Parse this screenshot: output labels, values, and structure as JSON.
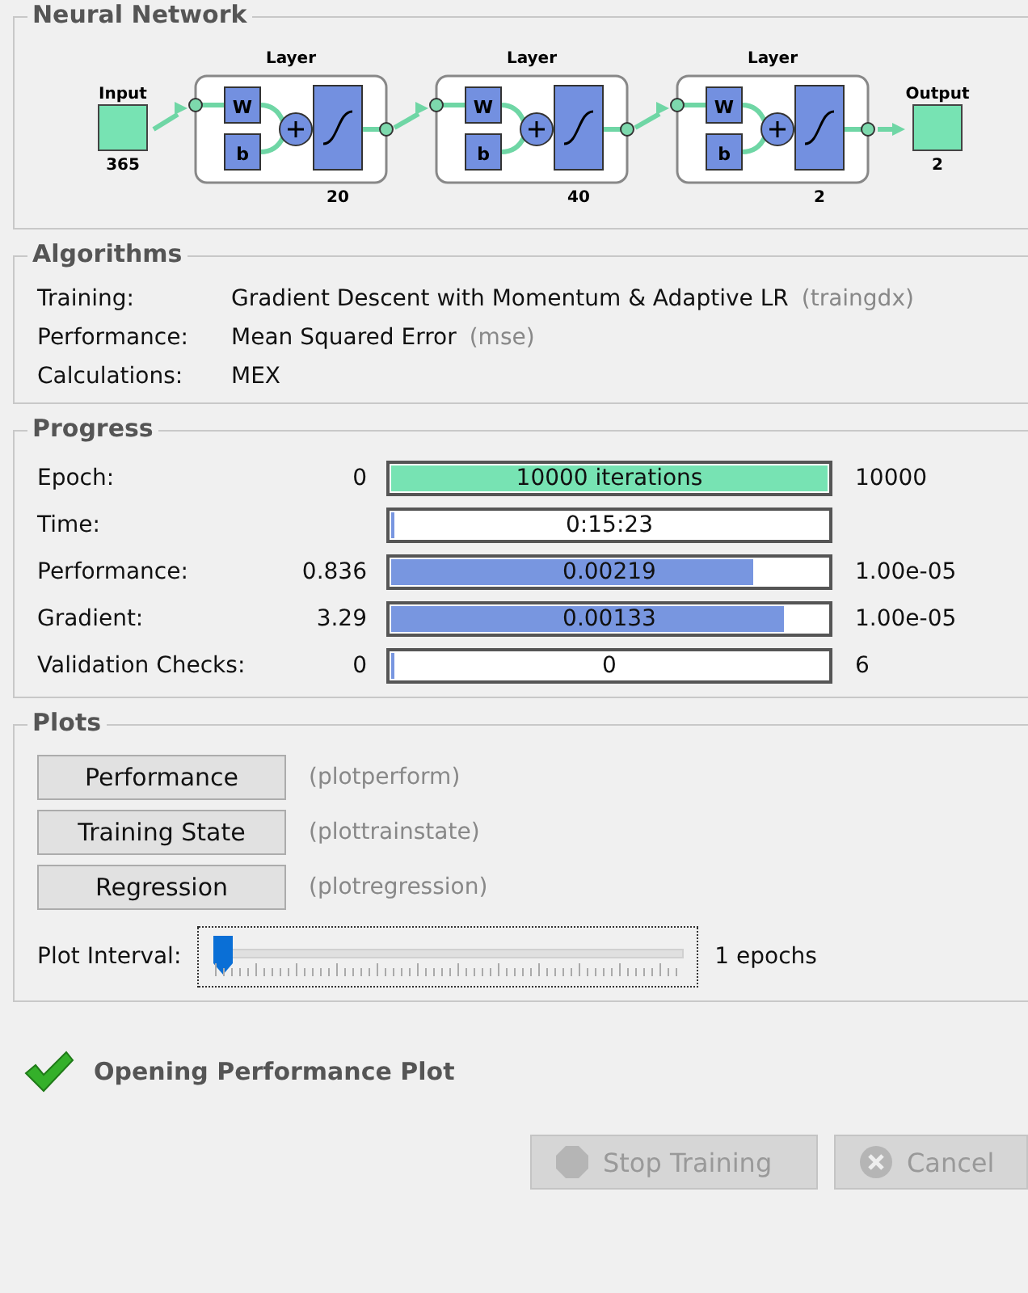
{
  "neural_network": {
    "title": "Neural Network",
    "input": {
      "label": "Input",
      "size": "365"
    },
    "layers": [
      {
        "label": "Layer",
        "size": "20",
        "weight_label": "W",
        "bias_label": "b"
      },
      {
        "label": "Layer",
        "size": "40",
        "weight_label": "W",
        "bias_label": "b"
      },
      {
        "label": "Layer",
        "size": "2",
        "weight_label": "W",
        "bias_label": "b"
      }
    ],
    "output": {
      "label": "Output",
      "size": "2"
    }
  },
  "algorithms": {
    "title": "Algorithms",
    "rows": [
      {
        "label": "Training:",
        "value": "Gradient Descent with Momentum & Adaptive LR",
        "code": "(traingdx)"
      },
      {
        "label": "Performance:",
        "value": "Mean Squared Error",
        "code": "(mse)"
      },
      {
        "label": "Calculations:",
        "value": "MEX"
      }
    ]
  },
  "progress": {
    "title": "Progress",
    "rows": [
      {
        "label": "Epoch:",
        "start": "0",
        "bar_text": "10000 iterations",
        "level": 1,
        "color": "#77e3b3",
        "end": "10000"
      },
      {
        "label": "Time:",
        "bar_text": "0:15:23",
        "level": 0,
        "color": "#7896e0"
      },
      {
        "label": "Performance:",
        "start": "0.836",
        "bar_text": "0.00219",
        "level": 0.83,
        "color": "#7896e0",
        "end": "1.00e-05"
      },
      {
        "label": "Gradient:",
        "start": "3.29",
        "bar_text": "0.00133",
        "level": 0.9,
        "color": "#7896e0",
        "end": "1.00e-05"
      },
      {
        "label": "Validation Checks:",
        "start": "0",
        "bar_text": "0",
        "level": 0,
        "color": "#7896e0",
        "end": "6"
      }
    ]
  },
  "plots": {
    "title": "Plots",
    "buttons": [
      {
        "label": "Performance",
        "function": "(plotperform)"
      },
      {
        "label": "Training State",
        "function": "(plottrainstate)"
      },
      {
        "label": "Regression",
        "function": "(plotregression)"
      }
    ],
    "plot_interval": {
      "label": "Plot Interval:",
      "level": 0,
      "reading": "1 epochs"
    }
  },
  "status": {
    "text": "Opening Performance Plot"
  },
  "buttons": [
    {
      "label": "Stop Training",
      "kind": "stop",
      "disabled": true
    },
    {
      "label": "Cancel",
      "kind": "cancel",
      "disabled": true
    }
  ]
}
